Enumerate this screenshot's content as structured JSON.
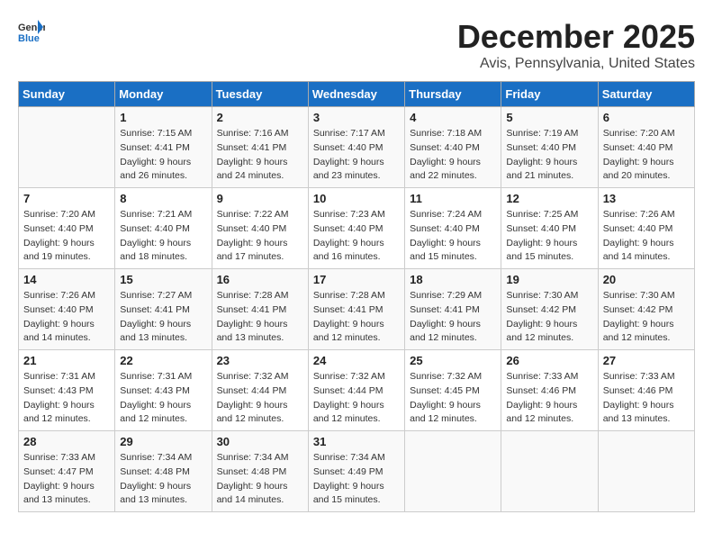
{
  "header": {
    "logo_general": "General",
    "logo_blue": "Blue",
    "title": "December 2025",
    "subtitle": "Avis, Pennsylvania, United States"
  },
  "days_of_week": [
    "Sunday",
    "Monday",
    "Tuesday",
    "Wednesday",
    "Thursday",
    "Friday",
    "Saturday"
  ],
  "weeks": [
    [
      {
        "num": "",
        "empty": true
      },
      {
        "num": "1",
        "sunrise": "7:15 AM",
        "sunset": "4:41 PM",
        "daylight": "9 hours and 26 minutes."
      },
      {
        "num": "2",
        "sunrise": "7:16 AM",
        "sunset": "4:41 PM",
        "daylight": "9 hours and 24 minutes."
      },
      {
        "num": "3",
        "sunrise": "7:17 AM",
        "sunset": "4:40 PM",
        "daylight": "9 hours and 23 minutes."
      },
      {
        "num": "4",
        "sunrise": "7:18 AM",
        "sunset": "4:40 PM",
        "daylight": "9 hours and 22 minutes."
      },
      {
        "num": "5",
        "sunrise": "7:19 AM",
        "sunset": "4:40 PM",
        "daylight": "9 hours and 21 minutes."
      },
      {
        "num": "6",
        "sunrise": "7:20 AM",
        "sunset": "4:40 PM",
        "daylight": "9 hours and 20 minutes."
      }
    ],
    [
      {
        "num": "7",
        "sunrise": "7:20 AM",
        "sunset": "4:40 PM",
        "daylight": "9 hours and 19 minutes."
      },
      {
        "num": "8",
        "sunrise": "7:21 AM",
        "sunset": "4:40 PM",
        "daylight": "9 hours and 18 minutes."
      },
      {
        "num": "9",
        "sunrise": "7:22 AM",
        "sunset": "4:40 PM",
        "daylight": "9 hours and 17 minutes."
      },
      {
        "num": "10",
        "sunrise": "7:23 AM",
        "sunset": "4:40 PM",
        "daylight": "9 hours and 16 minutes."
      },
      {
        "num": "11",
        "sunrise": "7:24 AM",
        "sunset": "4:40 PM",
        "daylight": "9 hours and 15 minutes."
      },
      {
        "num": "12",
        "sunrise": "7:25 AM",
        "sunset": "4:40 PM",
        "daylight": "9 hours and 15 minutes."
      },
      {
        "num": "13",
        "sunrise": "7:26 AM",
        "sunset": "4:40 PM",
        "daylight": "9 hours and 14 minutes."
      }
    ],
    [
      {
        "num": "14",
        "sunrise": "7:26 AM",
        "sunset": "4:40 PM",
        "daylight": "9 hours and 14 minutes."
      },
      {
        "num": "15",
        "sunrise": "7:27 AM",
        "sunset": "4:41 PM",
        "daylight": "9 hours and 13 minutes."
      },
      {
        "num": "16",
        "sunrise": "7:28 AM",
        "sunset": "4:41 PM",
        "daylight": "9 hours and 13 minutes."
      },
      {
        "num": "17",
        "sunrise": "7:28 AM",
        "sunset": "4:41 PM",
        "daylight": "9 hours and 12 minutes."
      },
      {
        "num": "18",
        "sunrise": "7:29 AM",
        "sunset": "4:41 PM",
        "daylight": "9 hours and 12 minutes."
      },
      {
        "num": "19",
        "sunrise": "7:30 AM",
        "sunset": "4:42 PM",
        "daylight": "9 hours and 12 minutes."
      },
      {
        "num": "20",
        "sunrise": "7:30 AM",
        "sunset": "4:42 PM",
        "daylight": "9 hours and 12 minutes."
      }
    ],
    [
      {
        "num": "21",
        "sunrise": "7:31 AM",
        "sunset": "4:43 PM",
        "daylight": "9 hours and 12 minutes."
      },
      {
        "num": "22",
        "sunrise": "7:31 AM",
        "sunset": "4:43 PM",
        "daylight": "9 hours and 12 minutes."
      },
      {
        "num": "23",
        "sunrise": "7:32 AM",
        "sunset": "4:44 PM",
        "daylight": "9 hours and 12 minutes."
      },
      {
        "num": "24",
        "sunrise": "7:32 AM",
        "sunset": "4:44 PM",
        "daylight": "9 hours and 12 minutes."
      },
      {
        "num": "25",
        "sunrise": "7:32 AM",
        "sunset": "4:45 PM",
        "daylight": "9 hours and 12 minutes."
      },
      {
        "num": "26",
        "sunrise": "7:33 AM",
        "sunset": "4:46 PM",
        "daylight": "9 hours and 12 minutes."
      },
      {
        "num": "27",
        "sunrise": "7:33 AM",
        "sunset": "4:46 PM",
        "daylight": "9 hours and 13 minutes."
      }
    ],
    [
      {
        "num": "28",
        "sunrise": "7:33 AM",
        "sunset": "4:47 PM",
        "daylight": "9 hours and 13 minutes."
      },
      {
        "num": "29",
        "sunrise": "7:34 AM",
        "sunset": "4:48 PM",
        "daylight": "9 hours and 13 minutes."
      },
      {
        "num": "30",
        "sunrise": "7:34 AM",
        "sunset": "4:48 PM",
        "daylight": "9 hours and 14 minutes."
      },
      {
        "num": "31",
        "sunrise": "7:34 AM",
        "sunset": "4:49 PM",
        "daylight": "9 hours and 15 minutes."
      },
      {
        "num": "",
        "empty": true
      },
      {
        "num": "",
        "empty": true
      },
      {
        "num": "",
        "empty": true
      }
    ]
  ]
}
